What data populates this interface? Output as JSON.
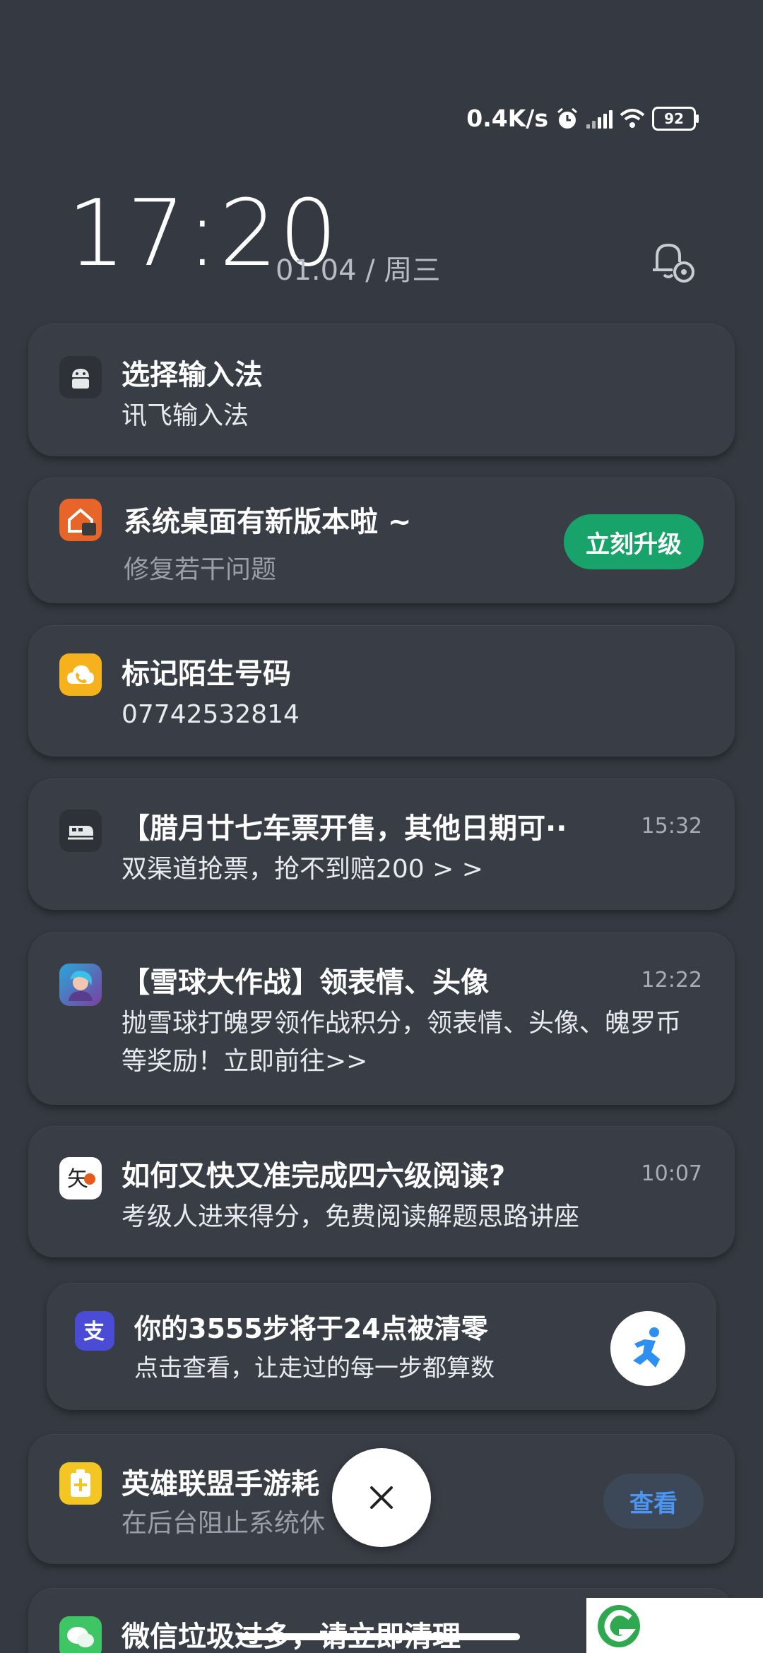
{
  "status_bar": {
    "net_speed": "0.4K/s",
    "battery": "92",
    "icons": [
      "alarm-icon",
      "signal-icon",
      "wifi-icon",
      "battery-icon"
    ]
  },
  "clock": {
    "time": "17:20",
    "date": "01.04 / 周三"
  },
  "notifications": [
    {
      "icon": "android-icon",
      "title": "选择输入法",
      "body": "讯飞输入法",
      "time": ""
    },
    {
      "icon": "mi-home-icon",
      "title": "系统桌面有新版本啦 ~",
      "body": "修复若干问题",
      "action": "立刻升级"
    },
    {
      "icon": "phone-cloud-icon",
      "title": "标记陌生号码",
      "body": "07742532814"
    },
    {
      "icon": "train-icon",
      "title": "【腊月廿七车票开售，其他日期可··",
      "body": "双渠道抢票，抢不到赔200 > >",
      "time": "15:32"
    },
    {
      "icon": "game-avatar-icon",
      "title": "【雪球大作战】领表情、头像",
      "body": "抛雪球打魄罗领作战积分，领表情、头像、魄罗币等奖励！立即前往>>",
      "time": "12:22"
    },
    {
      "icon": "zhihu-style-icon",
      "title": "如何又快又准完成四六级阅读?",
      "body": "考级人进来得分，免费阅读解题思路讲座",
      "time": "10:07"
    },
    {
      "icon": "alipay-icon",
      "title": "你的3555步将于24点被清零",
      "body": "点击查看，让走过的每一步都算数",
      "thumbnail": "running-man-icon"
    },
    {
      "icon": "battery-saver-icon",
      "title": "英雄联盟手游耗",
      "body": "在后台阻止系统休",
      "action": "查看"
    },
    {
      "icon": "wechat-cleaner-icon",
      "title": "微信垃圾过多，请立即清理"
    }
  ],
  "colors": {
    "background": "#353941",
    "card": "#393d45",
    "green_button": "#18a36a",
    "blue_text": "#4c95f0"
  }
}
